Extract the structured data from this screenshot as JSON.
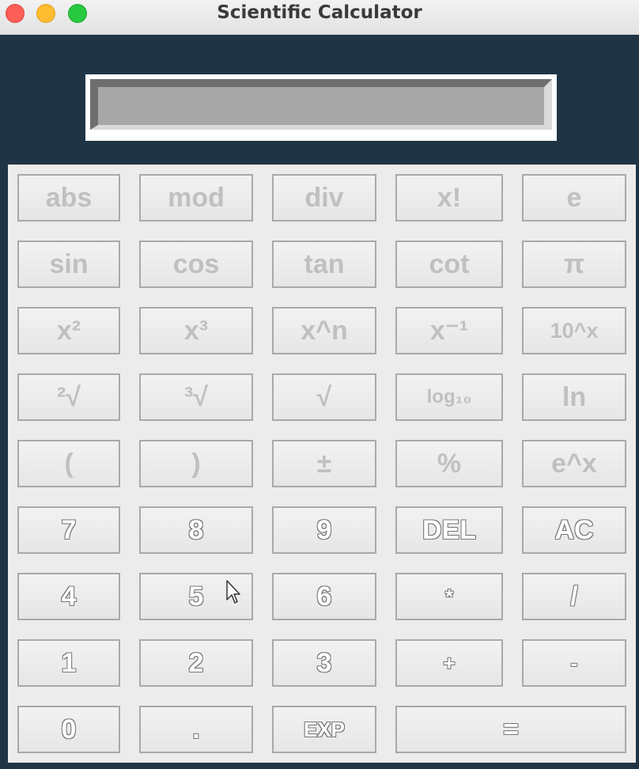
{
  "window": {
    "title": "Scientific Calculator"
  },
  "display": {
    "value": ""
  },
  "keys": {
    "abs": "abs",
    "mod": "mod",
    "div": "div",
    "fact": "x!",
    "e": "e",
    "sin": "sin",
    "cos": "cos",
    "tan": "tan",
    "cot": "cot",
    "pi": "π",
    "sq": "x²",
    "cube": "x³",
    "pow": "x^n",
    "inv": "x⁻¹",
    "tenx": "10^x",
    "sqrt2": "²√",
    "cbrt": "³√",
    "sqrt": "√",
    "log10": "log₁₀",
    "ln": "ln",
    "lparen": "(",
    "rparen": ")",
    "pm": "±",
    "percent": "%",
    "ex": "e^x",
    "d7": "7",
    "d8": "8",
    "d9": "9",
    "del": "DEL",
    "ac": "AC",
    "d4": "4",
    "d5": "5",
    "d6": "6",
    "mul": "*",
    "divide": "/",
    "d1": "1",
    "d2": "2",
    "d3": "3",
    "add": "+",
    "sub": "-",
    "d0": "0",
    "dot": ".",
    "exp": "EXP",
    "eq": "="
  },
  "colors": {
    "background": "#1f3546",
    "keypad": "#ececec",
    "display": "#a8a8a8"
  }
}
